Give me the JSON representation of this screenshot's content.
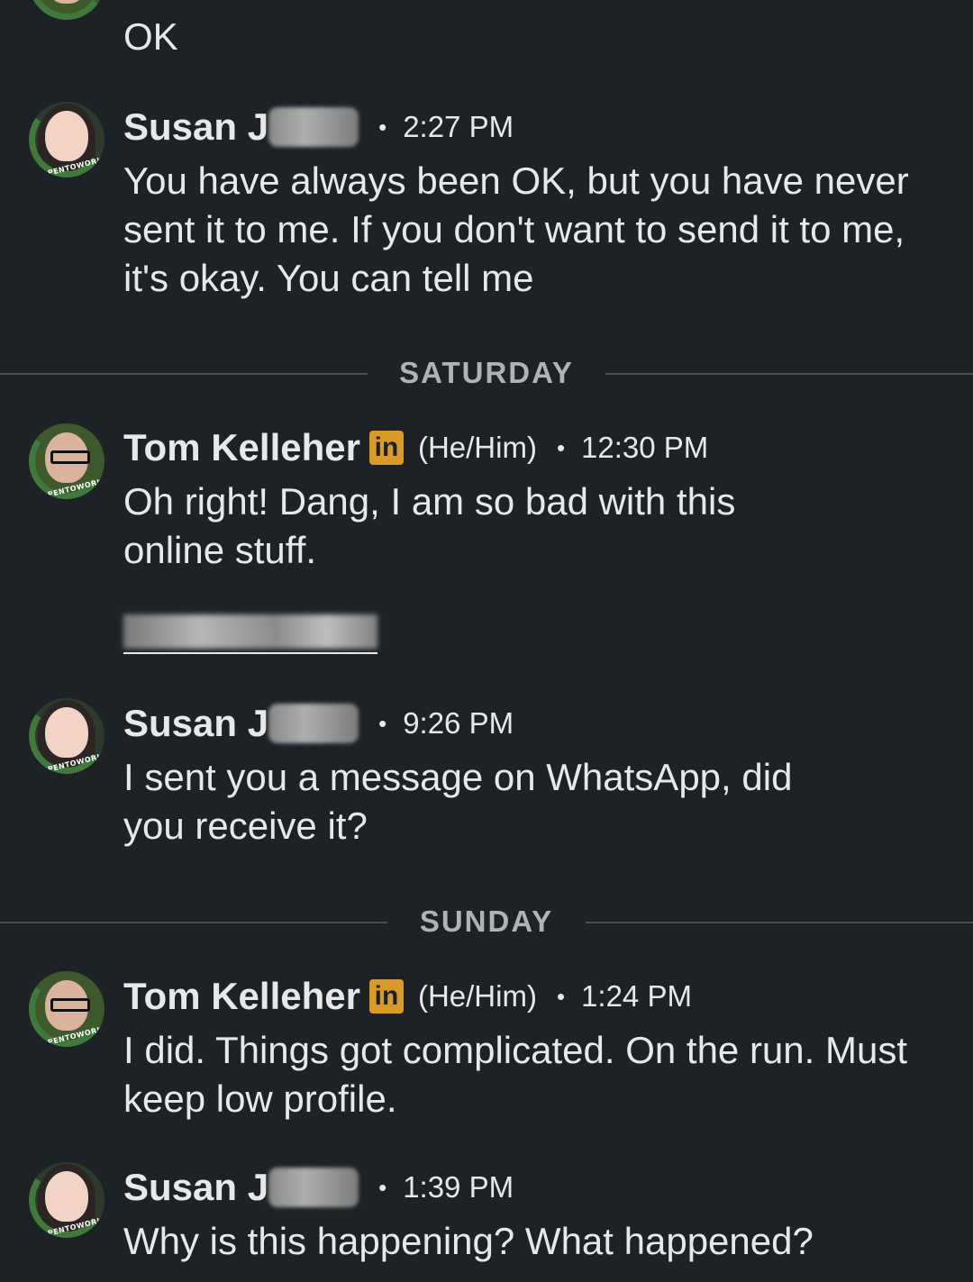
{
  "messages": [
    {
      "id": "m0",
      "text": "OK"
    },
    {
      "id": "m1",
      "sender": "Susan J",
      "time": "2:27 PM",
      "text": "You have always been OK, but you have never sent it to me. If you don't want to send it to me, it's okay. You can tell me"
    },
    {
      "id": "m2",
      "sender": "Tom Kelleher",
      "badge": "in",
      "pronouns": "(He/Him)",
      "time": "12:30 PM",
      "text": "Oh right!  Dang, I am so bad with this online stuff."
    },
    {
      "id": "m3",
      "sender": "Susan J",
      "time": "9:26 PM",
      "text": "I sent you a message on WhatsApp, did you receive it?"
    },
    {
      "id": "m4",
      "sender": "Tom Kelleher",
      "badge": "in",
      "pronouns": "(He/Him)",
      "time": "1:24 PM",
      "text": "I did.  Things got complicated.  On the run. Must keep low profile."
    },
    {
      "id": "m5",
      "sender": "Susan J",
      "time": "1:39 PM",
      "text": "Why is this happening? What happened?"
    }
  ],
  "dividers": {
    "saturday": "SATURDAY",
    "sunday": "SUNDAY"
  },
  "separator_dot": "•",
  "avatar_badge_text": "#OPENTOWORK",
  "colors": {
    "background": "#1d2226",
    "text": "#e8e8e8",
    "divider_line": "#4a4f53",
    "divider_text": "#b0b3b5",
    "linkedin_badge": "#d99a27",
    "opentowork_ring": "#3f7a3a"
  }
}
